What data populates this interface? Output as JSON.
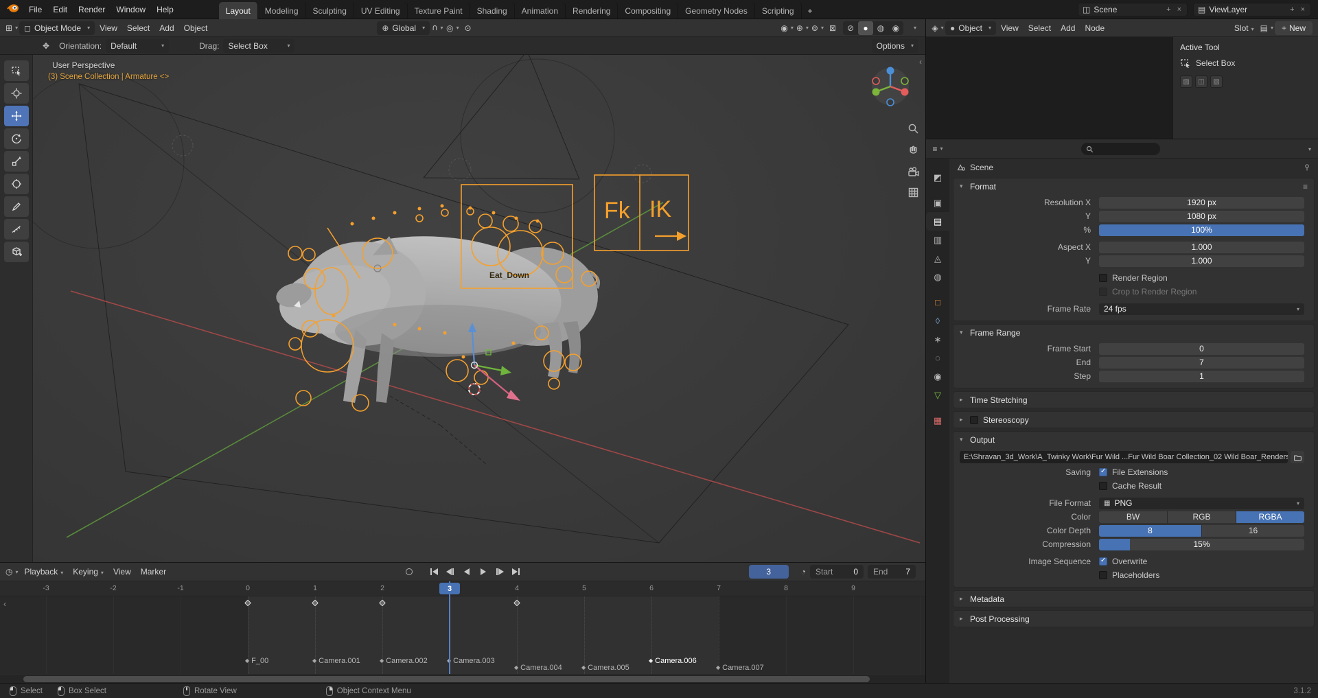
{
  "topbar": {
    "menus": [
      "File",
      "Edit",
      "Render",
      "Window",
      "Help"
    ],
    "workspaces": [
      "Layout",
      "Modeling",
      "Sculpting",
      "UV Editing",
      "Texture Paint",
      "Shading",
      "Animation",
      "Rendering",
      "Compositing",
      "Geometry Nodes",
      "Scripting"
    ],
    "add_workspace_label": "+",
    "scene": {
      "label": "Scene"
    },
    "viewlayer": {
      "label": "ViewL ayer"
    }
  },
  "viewport": {
    "header": {
      "mode": "Object Mode",
      "menus": [
        "View",
        "Select",
        "Add",
        "Object"
      ],
      "orientation": "Global",
      "options_label": "Options"
    },
    "tool_settings": {
      "orientation_label": "Orientation:",
      "orientation_value": "Default",
      "drag_label": "Drag:",
      "drag_value": "Select Box"
    },
    "overlay": {
      "view_label": "User Perspective",
      "context_label": "(3) Scene Collection | Armature <>"
    },
    "rig": {
      "fk": "Fk",
      "ik": "IK",
      "action_label": "Eat_Down"
    }
  },
  "shader_editor": {
    "shader_type": "Object",
    "menus": [
      "View",
      "Select",
      "Add",
      "Node"
    ],
    "slot_label": "Slot",
    "new_button": "New",
    "tool_panel": {
      "title": "Active Tool",
      "tool_name": "Select Box"
    }
  },
  "properties": {
    "breadcrumb": "Scene",
    "search_placeholder": "",
    "format": {
      "title": "Format",
      "resolution_x_label": "Resolution X",
      "resolution_x": "1920 px",
      "resolution_y_label": "Y",
      "resolution_y": "1080 px",
      "pct_label": "%",
      "pct": "100%",
      "aspect_x_label": "Aspect X",
      "aspect_x": "1.000",
      "aspect_y_label": "Y",
      "aspect_y": "1.000",
      "render_region_label": "Render Region",
      "crop_label": "Crop to Render Region",
      "frame_rate_label": "Frame Rate",
      "frame_rate": "24 fps"
    },
    "frame_range": {
      "title": "Frame Range",
      "start_label": "Frame Start",
      "start": "0",
      "end_label": "End",
      "end": "7",
      "step_label": "Step",
      "step": "1"
    },
    "time_stretching_title": "Time Stretching",
    "stereoscopy_title": "Stereoscopy",
    "output": {
      "title": "Output",
      "path": "E:\\Shravan_3d_Work\\A_Twinky Work\\Fur Wild ...Fur Wild Boar Collection_02 Wild Boar_Renders",
      "saving_label": "Saving",
      "file_extensions_label": "File Extensions",
      "cache_label": "Cache Result",
      "file_format_label": "File Format",
      "file_format": "PNG",
      "color_label": "Color",
      "color_options": [
        "BW",
        "RGB",
        "RGBA"
      ],
      "depth_label": "Color Depth",
      "depth_options": [
        "8",
        "16"
      ],
      "compression_label": "Compression",
      "compression": "15%",
      "sequence_label": "Image Sequence",
      "overwrite_label": "Overwrite",
      "placeholders_label": "Placeholders"
    },
    "metadata_title": "Metadata",
    "post_processing_title": "Post Processing"
  },
  "timeline": {
    "menus": [
      "Playback",
      "Keying",
      "View",
      "Marker"
    ],
    "current_frame": "3",
    "start_label": "Start",
    "start_value": "0",
    "end_label": "End",
    "end_value": "7",
    "ticks": [
      "-3",
      "-2",
      "-1",
      "0",
      "1",
      "2",
      "3",
      "4",
      "5",
      "6",
      "7",
      "8",
      "9"
    ],
    "markers": [
      {
        "name": "F_00"
      },
      {
        "name": "Camera.001"
      },
      {
        "name": "Camera.002"
      },
      {
        "name": "Camera.003"
      },
      {
        "name": "Camera.004"
      },
      {
        "name": "Camera.005"
      },
      {
        "name": "Camera.006",
        "selected": true
      },
      {
        "name": "Camera.007"
      }
    ]
  },
  "statusbar": {
    "select": "Select",
    "box_select": "Box Select",
    "rotate_view": "Rotate View",
    "context_menu": "Object Context Menu",
    "version": "3.1.2"
  },
  "colors": {
    "accent": "#4772b3",
    "rig_orange": "#f6a02c"
  }
}
